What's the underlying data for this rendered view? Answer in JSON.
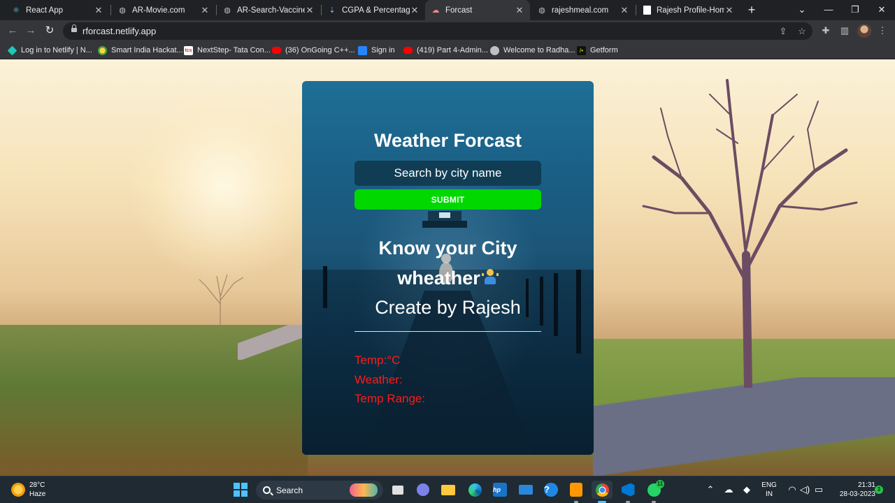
{
  "browser": {
    "tabs": [
      {
        "title": "React App",
        "icon": "react-icon",
        "active": false
      },
      {
        "title": "AR-Movie.com",
        "icon": "globe-icon",
        "active": false
      },
      {
        "title": "AR-Search-Vaccine-pu",
        "icon": "globe-icon",
        "active": false
      },
      {
        "title": "CGPA & Percentag",
        "icon": "cgpa-icon",
        "active": false
      },
      {
        "title": "Forcast",
        "icon": "cloud-icon",
        "active": true
      },
      {
        "title": "rajeshmeal.com",
        "icon": "globe-icon",
        "active": false
      },
      {
        "title": "Rajesh Profile-Home",
        "icon": "page-icon",
        "active": false
      }
    ],
    "url": "rforcast.netlify.app",
    "bookmarks": [
      {
        "label": "Log in to Netlify | N...",
        "icon": "netlify-icon"
      },
      {
        "label": "Smart India Hackat...",
        "icon": "bulb-icon"
      },
      {
        "label": "NextStep- Tata Con...",
        "icon": "tcs-icon"
      },
      {
        "label": "(36) OnGoing C++...",
        "icon": "youtube-icon"
      },
      {
        "label": "Sign in",
        "icon": "jira-icon"
      },
      {
        "label": "(419) Part 4-Admin...",
        "icon": "youtube-icon"
      },
      {
        "label": "Welcome to Radha...",
        "icon": "globe-icon"
      },
      {
        "label": "Getform",
        "icon": "getform-icon"
      }
    ]
  },
  "app": {
    "title": "Weather Forcast",
    "search_placeholder": "Search by city name",
    "submit_label": "SUBMIT",
    "headline": "Know your City wheather",
    "creator": "Create by Rajesh",
    "temp_label": "Temp:°C",
    "weather_label": "Weather:",
    "range_label": "Temp Range:",
    "stat_color": "#ff1a1a",
    "button_color": "#00d800"
  },
  "taskbar": {
    "weather_temp": "28°C",
    "weather_desc": "Haze",
    "search_label": "Search",
    "lang_top": "ENG",
    "lang_bottom": "IN",
    "time": "21:31",
    "date": "28-03-2023",
    "whatsapp_badge": "11",
    "notification_count": "3"
  }
}
